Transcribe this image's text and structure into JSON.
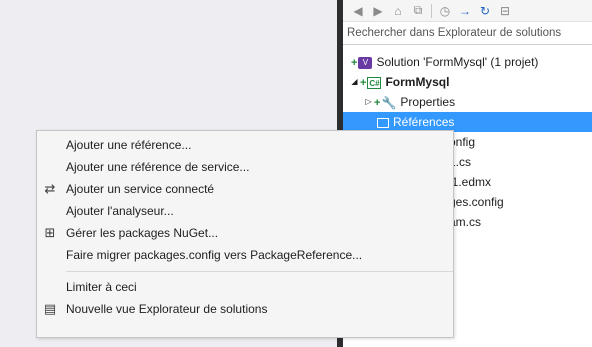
{
  "solution_explorer": {
    "search_placeholder": "Rechercher dans Explorateur de solutions",
    "toolbar_icons": [
      "back-icon",
      "forward-icon",
      "home-icon",
      "switch-views-icon",
      "history-icon",
      "sync-icon",
      "refresh-icon",
      "collapse-icon"
    ],
    "tree": [
      {
        "label": "Solution 'FormMysql' (1 projet)",
        "icon": "solution-icon"
      },
      {
        "label": "FormMysql",
        "icon": "csharp-project-icon"
      },
      {
        "label": "Properties",
        "icon": "wrench-icon"
      },
      {
        "label": "Références",
        "icon": "references-icon"
      },
      {
        "label": "onfig"
      },
      {
        "label": "1.cs"
      },
      {
        "label": "l1.edmx"
      },
      {
        "label": "ges.config"
      },
      {
        "label": "am.cs"
      }
    ]
  },
  "context_menu": {
    "items": [
      {
        "label": "Ajouter une référence...",
        "icon": ""
      },
      {
        "label": "Ajouter une référence de service...",
        "icon": ""
      },
      {
        "label": "Ajouter un service connecté",
        "icon": "connected-service-icon"
      },
      {
        "label": "Ajouter l'analyseur...",
        "icon": ""
      },
      {
        "label": "Gérer les packages NuGet...",
        "icon": "nuget-icon"
      },
      {
        "label": "Faire migrer packages.config vers PackageReference...",
        "icon": ""
      },
      {
        "label": "Limiter à ceci",
        "icon": ""
      },
      {
        "label": "Nouvelle vue Explorateur de solutions",
        "icon": "new-view-icon"
      }
    ]
  },
  "colors": {
    "selection": "#3399ff",
    "menu_background": "#f5f5f5",
    "dark_separator": "#2d2d30"
  }
}
